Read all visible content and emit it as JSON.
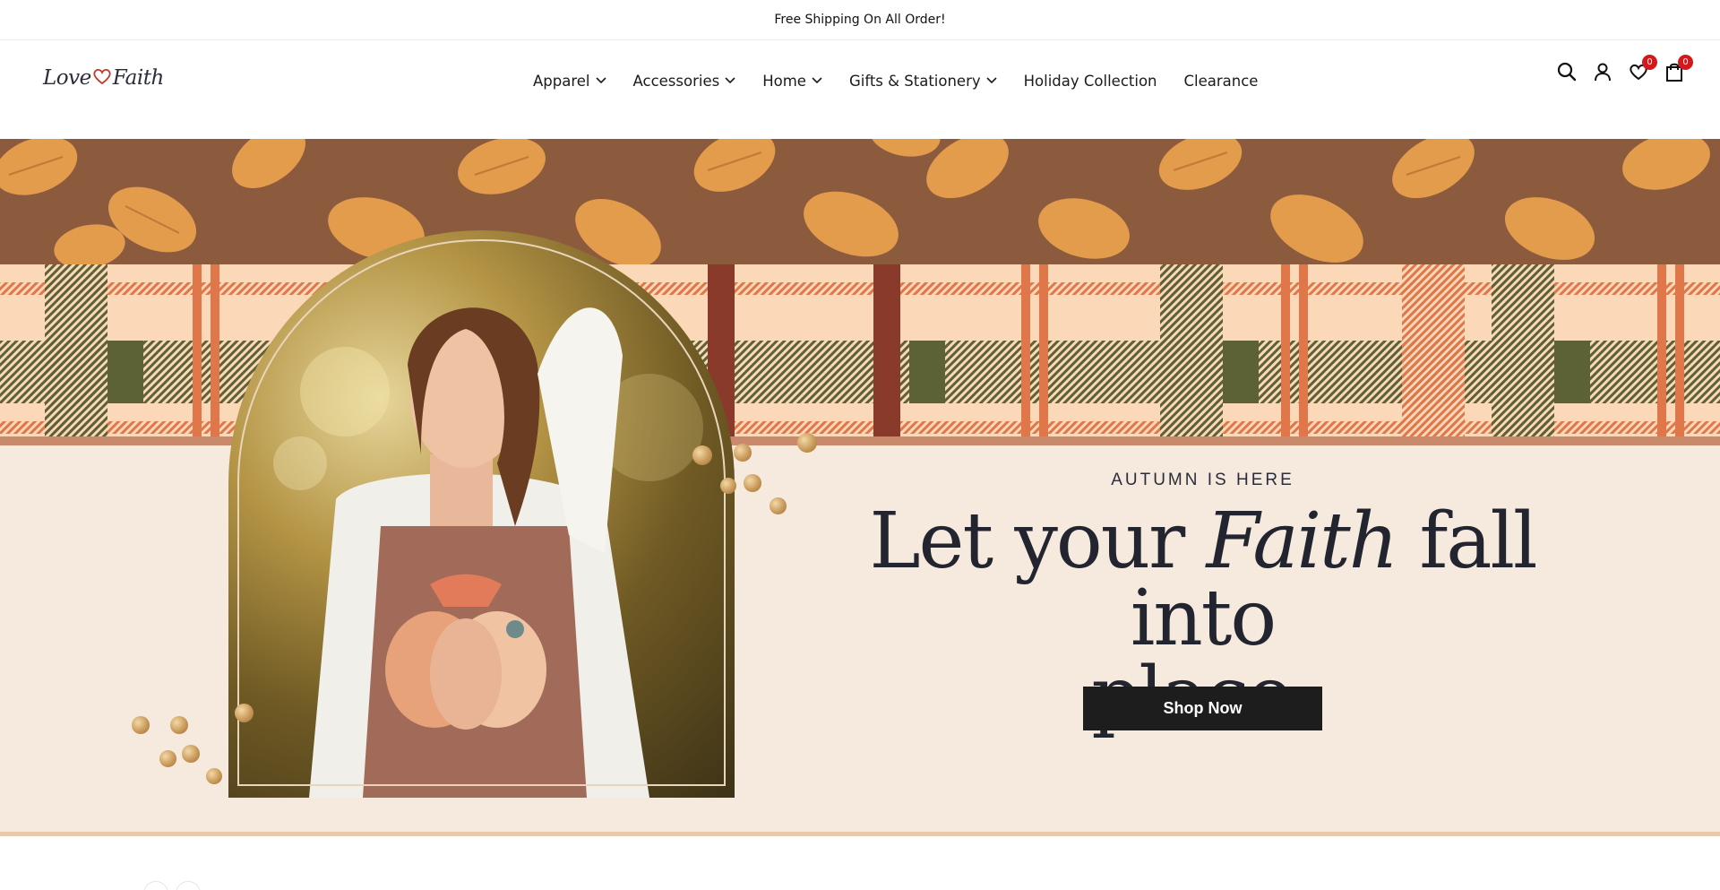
{
  "announcement": {
    "text": "Free Shipping On All Order!"
  },
  "brand": {
    "logo_text_left": "Love",
    "logo_text_right": "Faith"
  },
  "nav": {
    "items": [
      {
        "label": "Apparel",
        "has_dropdown": true
      },
      {
        "label": "Accessories",
        "has_dropdown": true
      },
      {
        "label": "Home",
        "has_dropdown": true
      },
      {
        "label": "Gifts & Stationery",
        "has_dropdown": true
      },
      {
        "label": "Holiday Collection",
        "has_dropdown": false
      },
      {
        "label": "Clearance",
        "has_dropdown": false
      }
    ]
  },
  "header_icons": {
    "search": "search-icon",
    "account": "user-icon",
    "wishlist": {
      "icon": "heart-icon",
      "count": "0"
    },
    "cart": {
      "icon": "shopping-bag-icon",
      "count": "0"
    }
  },
  "hero": {
    "eyebrow": "AUTUMN IS HERE",
    "headline_part1": "Let your ",
    "headline_em": "Faith",
    "headline_part2": " fall into",
    "headline_line2": "place.",
    "cta_label": "Shop Now",
    "colors": {
      "leaf_bg": "#8c5b3e",
      "leaf": "#e39b4c",
      "plaid_base": "#fbd8b8",
      "plaid_green": "#5c6236",
      "plaid_orange": "#e0774a",
      "cream": "#f6e9dd",
      "button": "#1d1d1d"
    }
  },
  "colors": {
    "badge": "#d2191c",
    "text": "#1b1b1b"
  }
}
